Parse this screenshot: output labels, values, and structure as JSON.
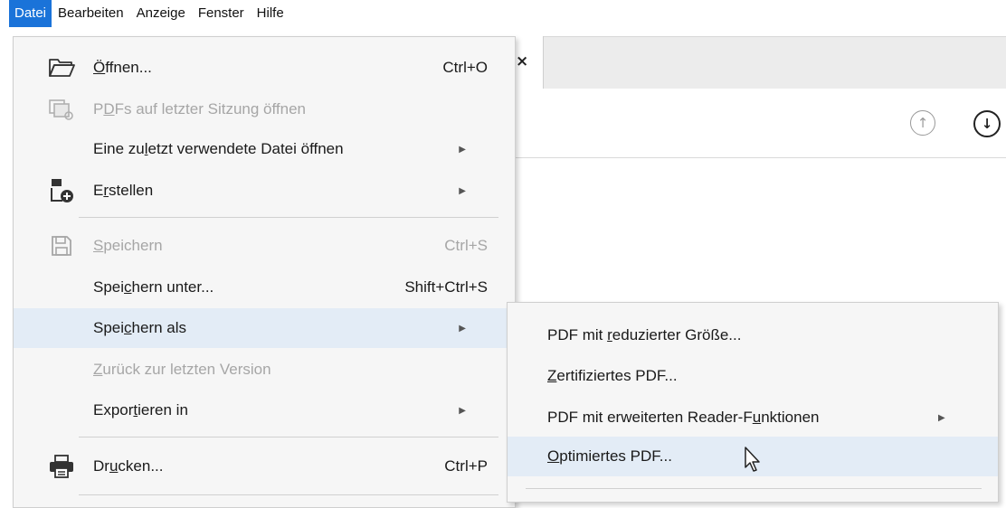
{
  "menubar": {
    "items": [
      "Datei",
      "Bearbeiten",
      "Anzeige",
      "Fenster",
      "Hilfe"
    ]
  },
  "tab": {
    "close_glyph": "×"
  },
  "toolbar": {
    "up_icon": "arrow-up-circle-icon",
    "down_icon": "arrow-down-circle-icon"
  },
  "file_menu": {
    "open": {
      "pre": "",
      "u": "Ö",
      "post": "ffnen...",
      "shortcut": "Ctrl+O",
      "icon": "folder-open-icon"
    },
    "reopen_session": {
      "pre": "P",
      "u": "D",
      "post": "Fs auf letzter Sitzung öffnen",
      "icon": "session-icon"
    },
    "recent": {
      "pre": "Eine zu",
      "u": "l",
      "post": "etzt verwendete Datei öffnen"
    },
    "create": {
      "pre": "E",
      "u": "r",
      "post": "stellen",
      "icon": "create-pdf-icon"
    },
    "save": {
      "pre": "",
      "u": "S",
      "post": "peichern",
      "shortcut": "Ctrl+S",
      "icon": "floppy-disk-icon"
    },
    "save_under": {
      "pre": "Spei",
      "u": "c",
      "post": "hern unter...",
      "shortcut": "Shift+Ctrl+S"
    },
    "save_as": {
      "pre": "Spei",
      "u": "c",
      "post": "hern als"
    },
    "revert": {
      "pre": "",
      "u": "Z",
      "post": "urück zur letzten Version"
    },
    "export": {
      "pre": "Expor",
      "u": "t",
      "post": "ieren in"
    },
    "print": {
      "pre": "Dr",
      "u": "u",
      "post": "cken...",
      "shortcut": "Ctrl+P",
      "icon": "printer-icon"
    }
  },
  "save_as_submenu": {
    "reduced": {
      "pre": "PDF mit ",
      "u": "r",
      "post": "eduzierter Größe..."
    },
    "certified": {
      "pre": "",
      "u": "Z",
      "post": "ertifiziertes PDF..."
    },
    "reader_ext": {
      "pre": "PDF mit erweiterten Reader-F",
      "u": "u",
      "post": "nktionen"
    },
    "optimized": {
      "pre": "",
      "u": "O",
      "post": "ptimiertes PDF..."
    }
  },
  "colors": {
    "menubar_active": "#1a73d9",
    "menu_bg": "#f6f6f6",
    "highlight": "#e3ecf6",
    "disabled_text": "#a6a6a6"
  }
}
